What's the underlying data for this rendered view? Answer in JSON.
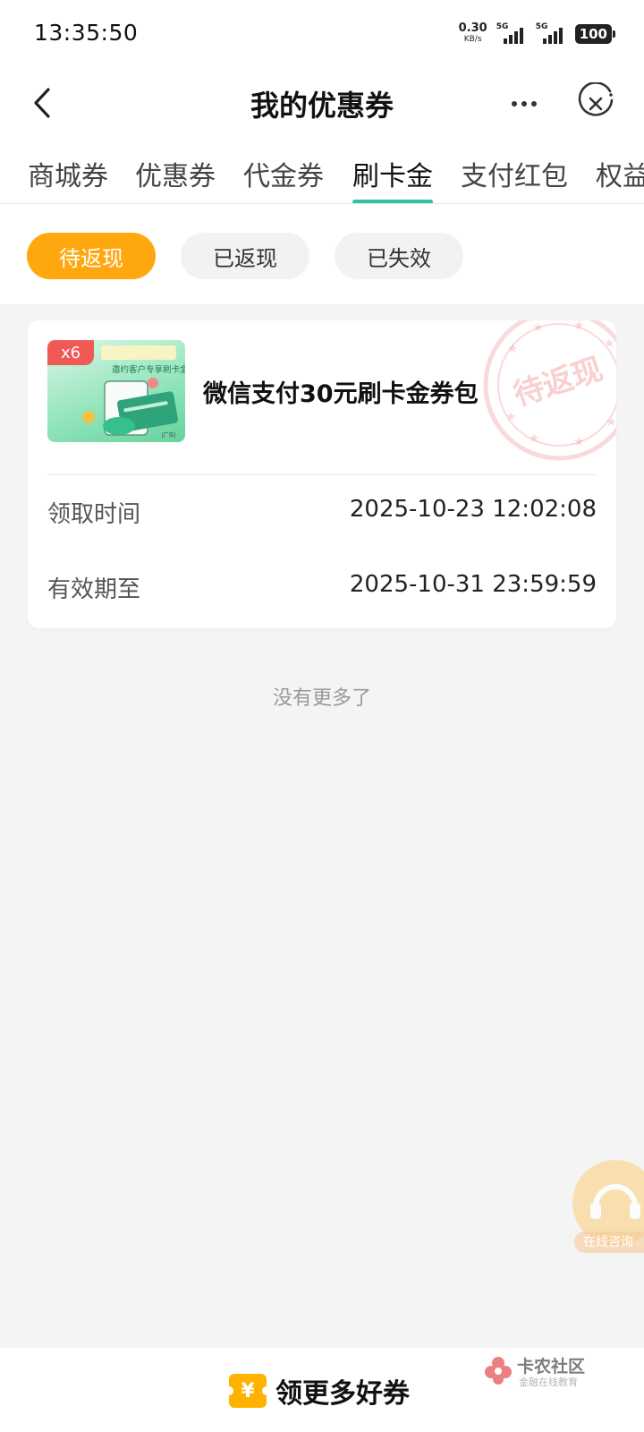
{
  "status_bar": {
    "time": "13:35:50",
    "net_speed_value": "0.30",
    "net_speed_unit": "KB/s",
    "sim1_label": "5G",
    "sim2_label": "5G",
    "battery": "100"
  },
  "header": {
    "title": "我的优惠券",
    "back_icon": "chevron-left-icon",
    "more_icon": "more-dots-icon",
    "close_icon": "close-circle-icon"
  },
  "tabs": [
    {
      "label": "商城券"
    },
    {
      "label": "优惠券"
    },
    {
      "label": "代金券"
    },
    {
      "label": "刷卡金",
      "active": true
    },
    {
      "label": "支付红包"
    },
    {
      "label": "权益"
    }
  ],
  "filters": [
    {
      "label": "待返现",
      "active": true
    },
    {
      "label": "已返现"
    },
    {
      "label": "已失效"
    }
  ],
  "coupon": {
    "quantity_badge": "x6",
    "title": "微信支付30元刷卡金券包",
    "stamp_text": "待返现",
    "thumb_text": "邀约客户专享刷卡金券包",
    "fields": [
      {
        "label": "领取时间",
        "value": "2025-10-23 12:02:08"
      },
      {
        "label": "有效期至",
        "value": "2025-10-31 23:59:59"
      }
    ]
  },
  "list_end_text": "没有更多了",
  "floating_service": {
    "label": "在线咨询",
    "icon": "customer-service-icon"
  },
  "bottom_bar": {
    "button_label": "领更多好券",
    "icon": "coupon-yen-icon"
  },
  "watermark": {
    "title": "卡农社区",
    "subtitle": "金融在线教育"
  },
  "colors": {
    "accent_orange": "#ffa70f",
    "tab_indicator": "#2ec0a8",
    "badge_red": "#f05a55",
    "stamp_red": "#e85a5a"
  }
}
